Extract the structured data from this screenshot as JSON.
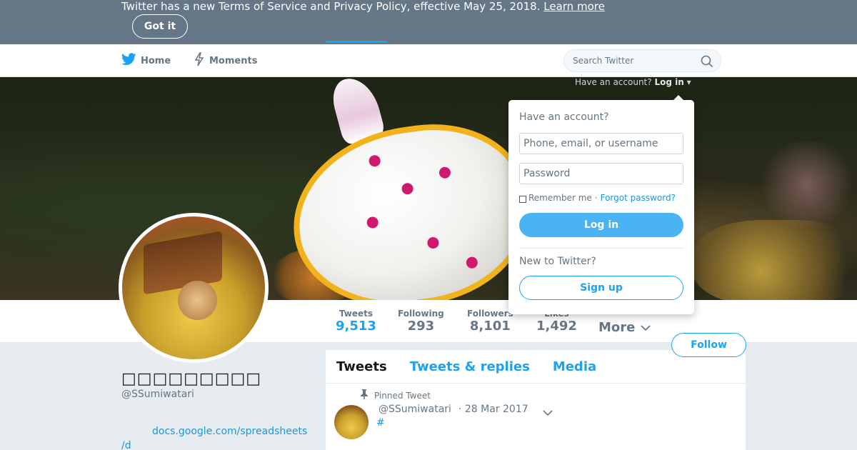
{
  "banner": {
    "text": "Twitter has a new Terms of Service and Privacy Policy, effective May 25, 2018.",
    "learn_more": "Learn more",
    "got_it": "Got it"
  },
  "nav": {
    "home": "Home",
    "moments": "Moments",
    "search_placeholder": "Search Twitter",
    "have_account": "Have an account?",
    "log_in": "Log in"
  },
  "profile": {
    "name": "□□□□□□□□□",
    "handle": "@SSumiwatari",
    "link_line1": "docs.google.com/spreadsheets",
    "link_line2": "/d",
    "follow": "Follow"
  },
  "stats": [
    {
      "label": "Tweets",
      "value": "9,513"
    },
    {
      "label": "Following",
      "value": "293"
    },
    {
      "label": "Followers",
      "value": "8,101"
    },
    {
      "label": "Likes",
      "value": "1,492"
    }
  ],
  "more": "More",
  "timeline": {
    "tabs": [
      "Tweets",
      "Tweets & replies",
      "Media"
    ],
    "pinned_label": "Pinned Tweet",
    "tweet": {
      "handle": "@SSumiwatari",
      "date": "· 28 Mar 2017",
      "text": "#"
    }
  },
  "login_dropdown": {
    "heading": "Have an account?",
    "username_placeholder": "Phone, email, or username",
    "password_placeholder": "Password",
    "remember": "Remember me",
    "separator": "·",
    "forgot": "Forgot password?",
    "login_button": "Log in",
    "new_to_twitter": "New to Twitter?",
    "signup_button": "Sign up"
  },
  "colors": {
    "accent": "#1da1f2",
    "banner_bg": "#657786",
    "page_bg": "#e6ecf0"
  }
}
